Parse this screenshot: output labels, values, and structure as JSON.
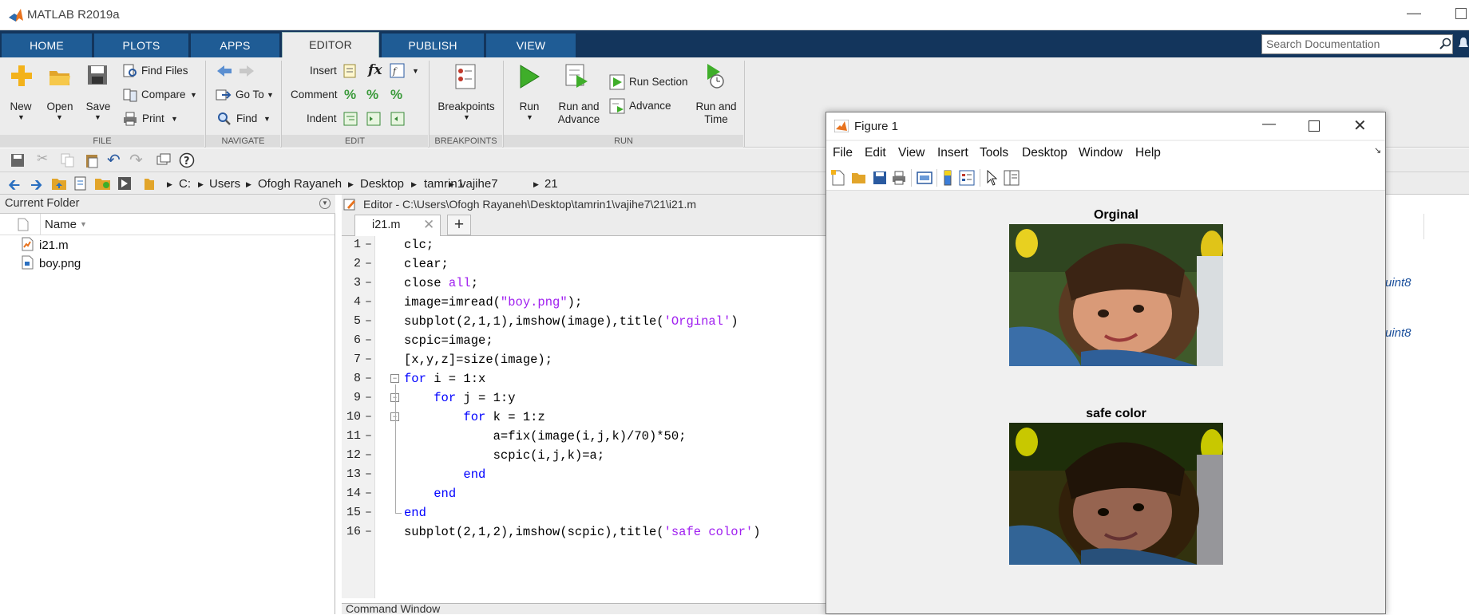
{
  "app": {
    "title": "MATLAB R2019a"
  },
  "ribbon_tabs": [
    "HOME",
    "PLOTS",
    "APPS",
    "EDITOR",
    "PUBLISH",
    "VIEW"
  ],
  "search": {
    "placeholder": "Search Documentation"
  },
  "ribbon": {
    "file": {
      "new": "New",
      "open": "Open",
      "save": "Save",
      "find_files": "Find Files",
      "compare": "Compare",
      "print": "Print",
      "group": "FILE"
    },
    "navigate": {
      "go_to": "Go To",
      "find": "Find",
      "group": "NAVIGATE"
    },
    "edit": {
      "insert": "Insert",
      "comment": "Comment",
      "indent": "Indent",
      "fx": "fx",
      "group": "EDIT"
    },
    "breakpoints": {
      "label": "Breakpoints",
      "group": "BREAKPOINTS"
    },
    "run": {
      "run": "Run",
      "run_advance_1": "Run and",
      "run_advance_2": "Advance",
      "run_section": "Run Section",
      "advance": "Advance",
      "run_time_1": "Run and",
      "run_time_2": "Time",
      "group": "RUN"
    }
  },
  "address": [
    "C:",
    "Users",
    "Ofogh Rayaneh",
    "Desktop",
    "tamrin1",
    "vajihe7",
    "21"
  ],
  "current_folder": {
    "title": "Current Folder",
    "column": "Name",
    "files": [
      "i21.m",
      "boy.png"
    ]
  },
  "editor": {
    "title": "Editor - C:\\Users\\Ofogh Rayaneh\\Desktop\\tamrin1\\vajihe7\\21\\i21.m",
    "tab": "i21.m",
    "line_numbers": [
      "1",
      "2",
      "3",
      "4",
      "5",
      "6",
      "7",
      "8",
      "9",
      "10",
      "11",
      "12",
      "13",
      "14",
      "15",
      "16"
    ],
    "lines": [
      {
        "pre": "clc;"
      },
      {
        "pre": "clear;"
      },
      {
        "pre": "close ",
        "str": "all",
        "post": ";"
      },
      {
        "pre": "image=imread(",
        "str": "\"boy.png\"",
        "post": ");"
      },
      {
        "pre": "subplot(2,1,1),imshow(image),title(",
        "str": "'Orginal'",
        "post": ")"
      },
      {
        "pre": "scpic=image;"
      },
      {
        "pre": "[x,y,z]=size(image);"
      },
      {
        "kw": "for",
        "post": " i = 1:x"
      },
      {
        "indent": "    ",
        "kw": "for",
        "post": " j = 1:y"
      },
      {
        "indent": "        ",
        "kw": "for",
        "post": " k = 1:z"
      },
      {
        "indent": "            ",
        "pre": "a=fix(image(i,j,k)/70)*50;"
      },
      {
        "indent": "            ",
        "pre": "scpic(i,j,k)=a;"
      },
      {
        "indent": "        ",
        "kw": "end"
      },
      {
        "indent": "    ",
        "kw": "end"
      },
      {
        "kw": "end"
      },
      {
        "pre": "subplot(2,1,2),imshow(scpic),title(",
        "str": "'safe color'",
        "post": ")"
      }
    ]
  },
  "command_window": {
    "title": "Command Window"
  },
  "workspace_values": [
    "uint8",
    "uint8"
  ],
  "figure": {
    "title": "Figure 1",
    "menu": [
      "File",
      "Edit",
      "View",
      "Insert",
      "Tools",
      "Desktop",
      "Window",
      "Help"
    ],
    "plot1_title": "Orginal",
    "plot2_title": "safe color"
  },
  "colors": {
    "ribbon_dark": "#13355c",
    "tab_blue": "#1f5c95",
    "keyword": "#0000ff",
    "string": "#a020f0"
  }
}
